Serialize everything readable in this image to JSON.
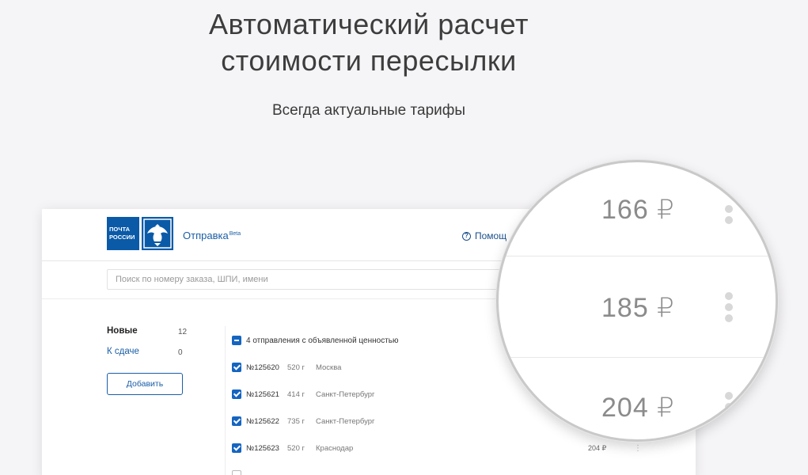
{
  "hero": {
    "title_line1": "Автоматический расчет",
    "title_line2": "стоимости пересылки",
    "subtitle": "Всегда актуальные тарифы"
  },
  "app": {
    "logo_text_line1": "ПОЧТА",
    "logo_text_line2": "РОССИИ",
    "name": "Отправка",
    "name_badge": "Beta",
    "help_label": "Помощ",
    "search_placeholder": "Поиск по номеру заказа, ШПИ, имени",
    "sidebar": [
      {
        "label": "Новые",
        "count": "12"
      },
      {
        "label": "К сдаче",
        "count": "0"
      }
    ],
    "add_button": "Добавить",
    "group_label": "4 отправления с объявленной ценностью",
    "orders": [
      {
        "num": "№125620",
        "weight": "520 г",
        "city": "Москва",
        "price": "",
        "checked": true
      },
      {
        "num": "№125621",
        "weight": "414 г",
        "city": "Санкт-Петербург",
        "price": "",
        "checked": true
      },
      {
        "num": "№125622",
        "weight": "735 г",
        "city": "Санкт-Петербург",
        "price": "",
        "checked": true
      },
      {
        "num": "№125623",
        "weight": "520 г",
        "city": "Краснодар",
        "price": "204 ₽",
        "checked": true
      },
      {
        "num": "",
        "weight": "",
        "city": "",
        "price": "",
        "checked": false
      }
    ]
  },
  "magnifier": {
    "prices": [
      "166 ₽",
      "185 ₽",
      "204 ₽"
    ]
  },
  "colors": {
    "brand_blue": "#0a5aa8",
    "checkbox_blue": "#1565c0",
    "background": "#f5f4f6"
  }
}
